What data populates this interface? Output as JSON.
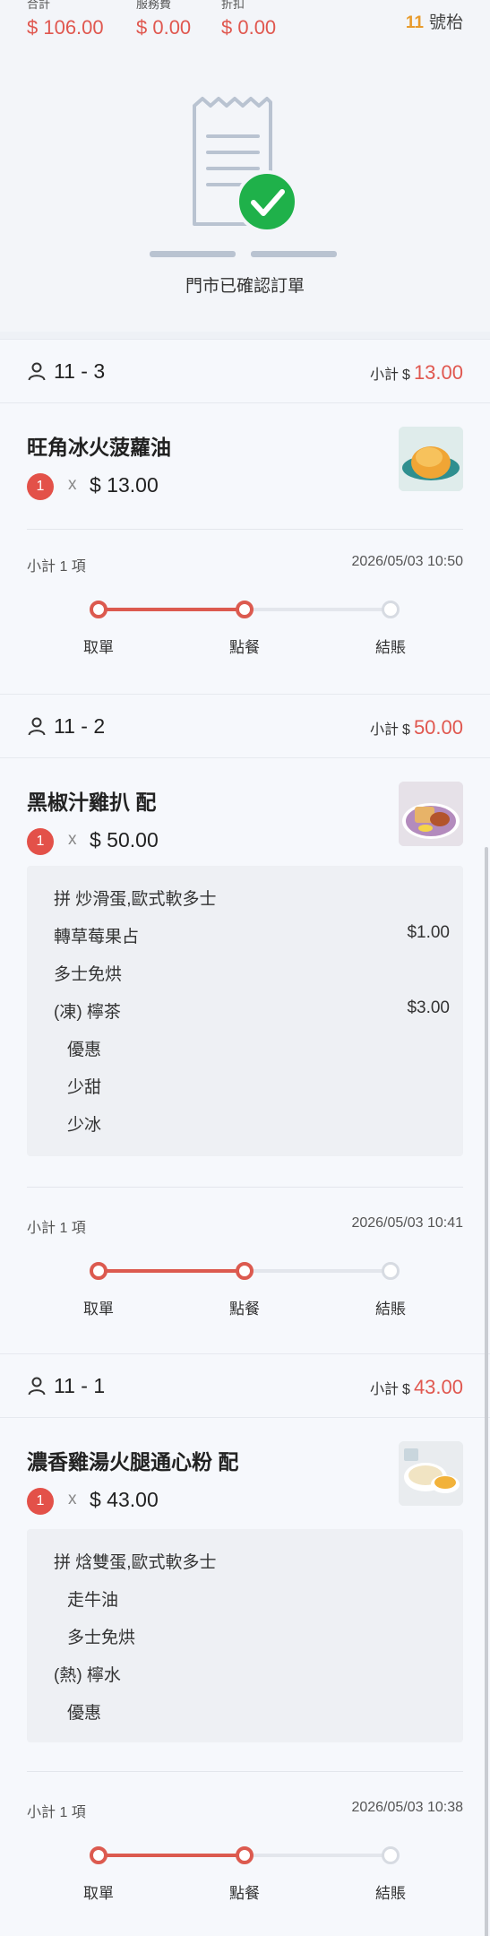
{
  "summary": {
    "total_label": "合計",
    "total_value": "$ 106.00",
    "service_label": "服務費",
    "service_value": "$ 0.00",
    "discount_label": "折扣",
    "discount_value": "$ 0.00",
    "table_number": "11",
    "table_suffix": "號枱"
  },
  "confirmation": {
    "status_text": "門市已確認訂單",
    "icon": "receipt-check-icon",
    "accent_color": "#1fb14a"
  },
  "orders": [
    {
      "id": "11 - 3",
      "subtotal_label": "小計",
      "currency": "$",
      "subtotal": "13.00",
      "item": {
        "name": "旺角冰火菠蘿油",
        "qty": "1",
        "x": "x",
        "price": "$ 13.00",
        "options": []
      },
      "count_label": "小計 1 項",
      "timestamp": "2026/05/03 10:50",
      "steps": [
        "取單",
        "點餐",
        "結賬"
      ],
      "progress_step": 2
    },
    {
      "id": "11 - 2",
      "subtotal_label": "小計",
      "currency": "$",
      "subtotal": "50.00",
      "item": {
        "name": "黑椒汁雞扒 配",
        "qty": "1",
        "x": "x",
        "price": "$ 50.00",
        "options": [
          {
            "text": "拼 炒滑蛋,歐式軟多士",
            "price": ""
          },
          {
            "text": "轉草莓果占",
            "price": "$1.00"
          },
          {
            "text": "多士免烘",
            "price": ""
          },
          {
            "text": "(凍) 檸茶",
            "price": "$3.00"
          },
          {
            "text": "優惠",
            "price": ""
          },
          {
            "text": "少甜",
            "price": ""
          },
          {
            "text": "少冰",
            "price": ""
          }
        ]
      },
      "count_label": "小計 1 項",
      "timestamp": "2026/05/03 10:41",
      "steps": [
        "取單",
        "點餐",
        "結賬"
      ],
      "progress_step": 2
    },
    {
      "id": "11 - 1",
      "subtotal_label": "小計",
      "currency": "$",
      "subtotal": "43.00",
      "item": {
        "name": "濃香雞湯火腿通心粉 配",
        "qty": "1",
        "x": "x",
        "price": "$ 43.00",
        "options": [
          {
            "text": "拼 焓雙蛋,歐式軟多士",
            "price": ""
          },
          {
            "text": "走牛油",
            "price": ""
          },
          {
            "text": "多士免烘",
            "price": ""
          },
          {
            "text": "(熱) 檸水",
            "price": ""
          },
          {
            "text": "優惠",
            "price": ""
          }
        ]
      },
      "count_label": "小計 1 項",
      "timestamp": "2026/05/03 10:38",
      "steps": [
        "取單",
        "點餐",
        "結賬"
      ],
      "progress_step": 2
    }
  ],
  "colors": {
    "accent_red": "#e0574f",
    "table_number": "#e89b2c",
    "check_green": "#1fb14a"
  }
}
